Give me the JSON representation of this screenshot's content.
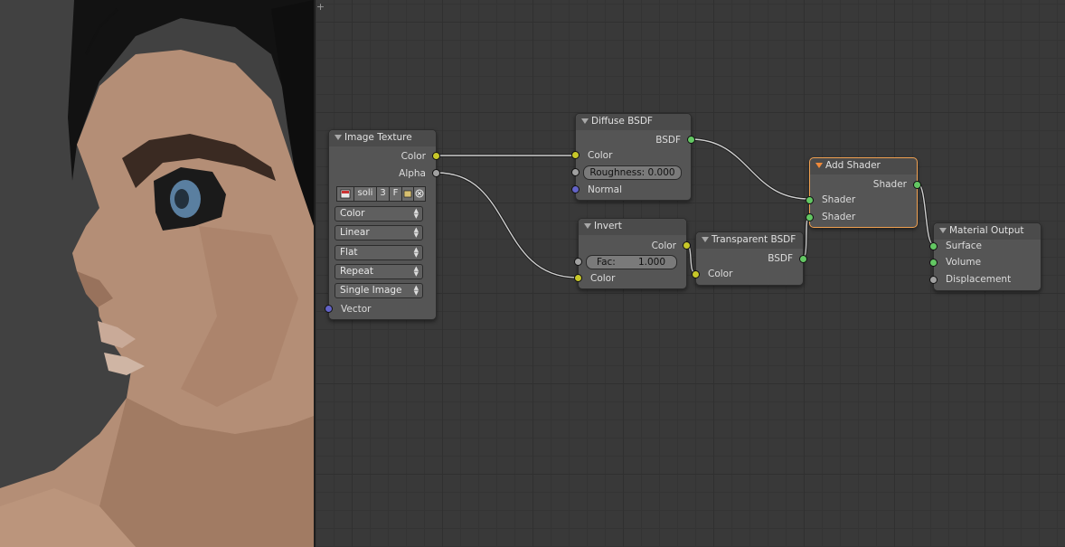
{
  "editor": {
    "corner_buttons": [
      "+",
      "+"
    ]
  },
  "nodes": {
    "image_texture": {
      "title": "Image Texture",
      "outputs": [
        "Color",
        "Alpha"
      ],
      "image_name": "soli",
      "users": "3",
      "fake_user": "F",
      "color_space": "Color",
      "interpolation": "Linear",
      "projection": "Flat",
      "extension": "Repeat",
      "source": "Single Image",
      "input_vector": "Vector"
    },
    "diffuse_bsdf": {
      "title": "Diffuse BSDF",
      "output": "BSDF",
      "input_color": "Color",
      "roughness": "Roughness: 0.000",
      "input_normal": "Normal"
    },
    "invert": {
      "title": "Invert",
      "output": "Color",
      "fac_label": "Fac:",
      "fac_value": "1.000",
      "input_color": "Color"
    },
    "transparent_bsdf": {
      "title": "Transparent BSDF",
      "output": "BSDF",
      "input_color": "Color"
    },
    "add_shader": {
      "title": "Add Shader",
      "output": "Shader",
      "inputs": [
        "Shader",
        "Shader"
      ]
    },
    "material_output": {
      "title": "Material Output",
      "inputs": [
        "Surface",
        "Volume",
        "Displacement"
      ]
    }
  },
  "colors": {
    "socket_color": "#c7c729",
    "socket_float": "#a1a1a1",
    "socket_shader": "#63c763",
    "socket_vector": "#6363c7",
    "active_outline": "#f0a050"
  }
}
